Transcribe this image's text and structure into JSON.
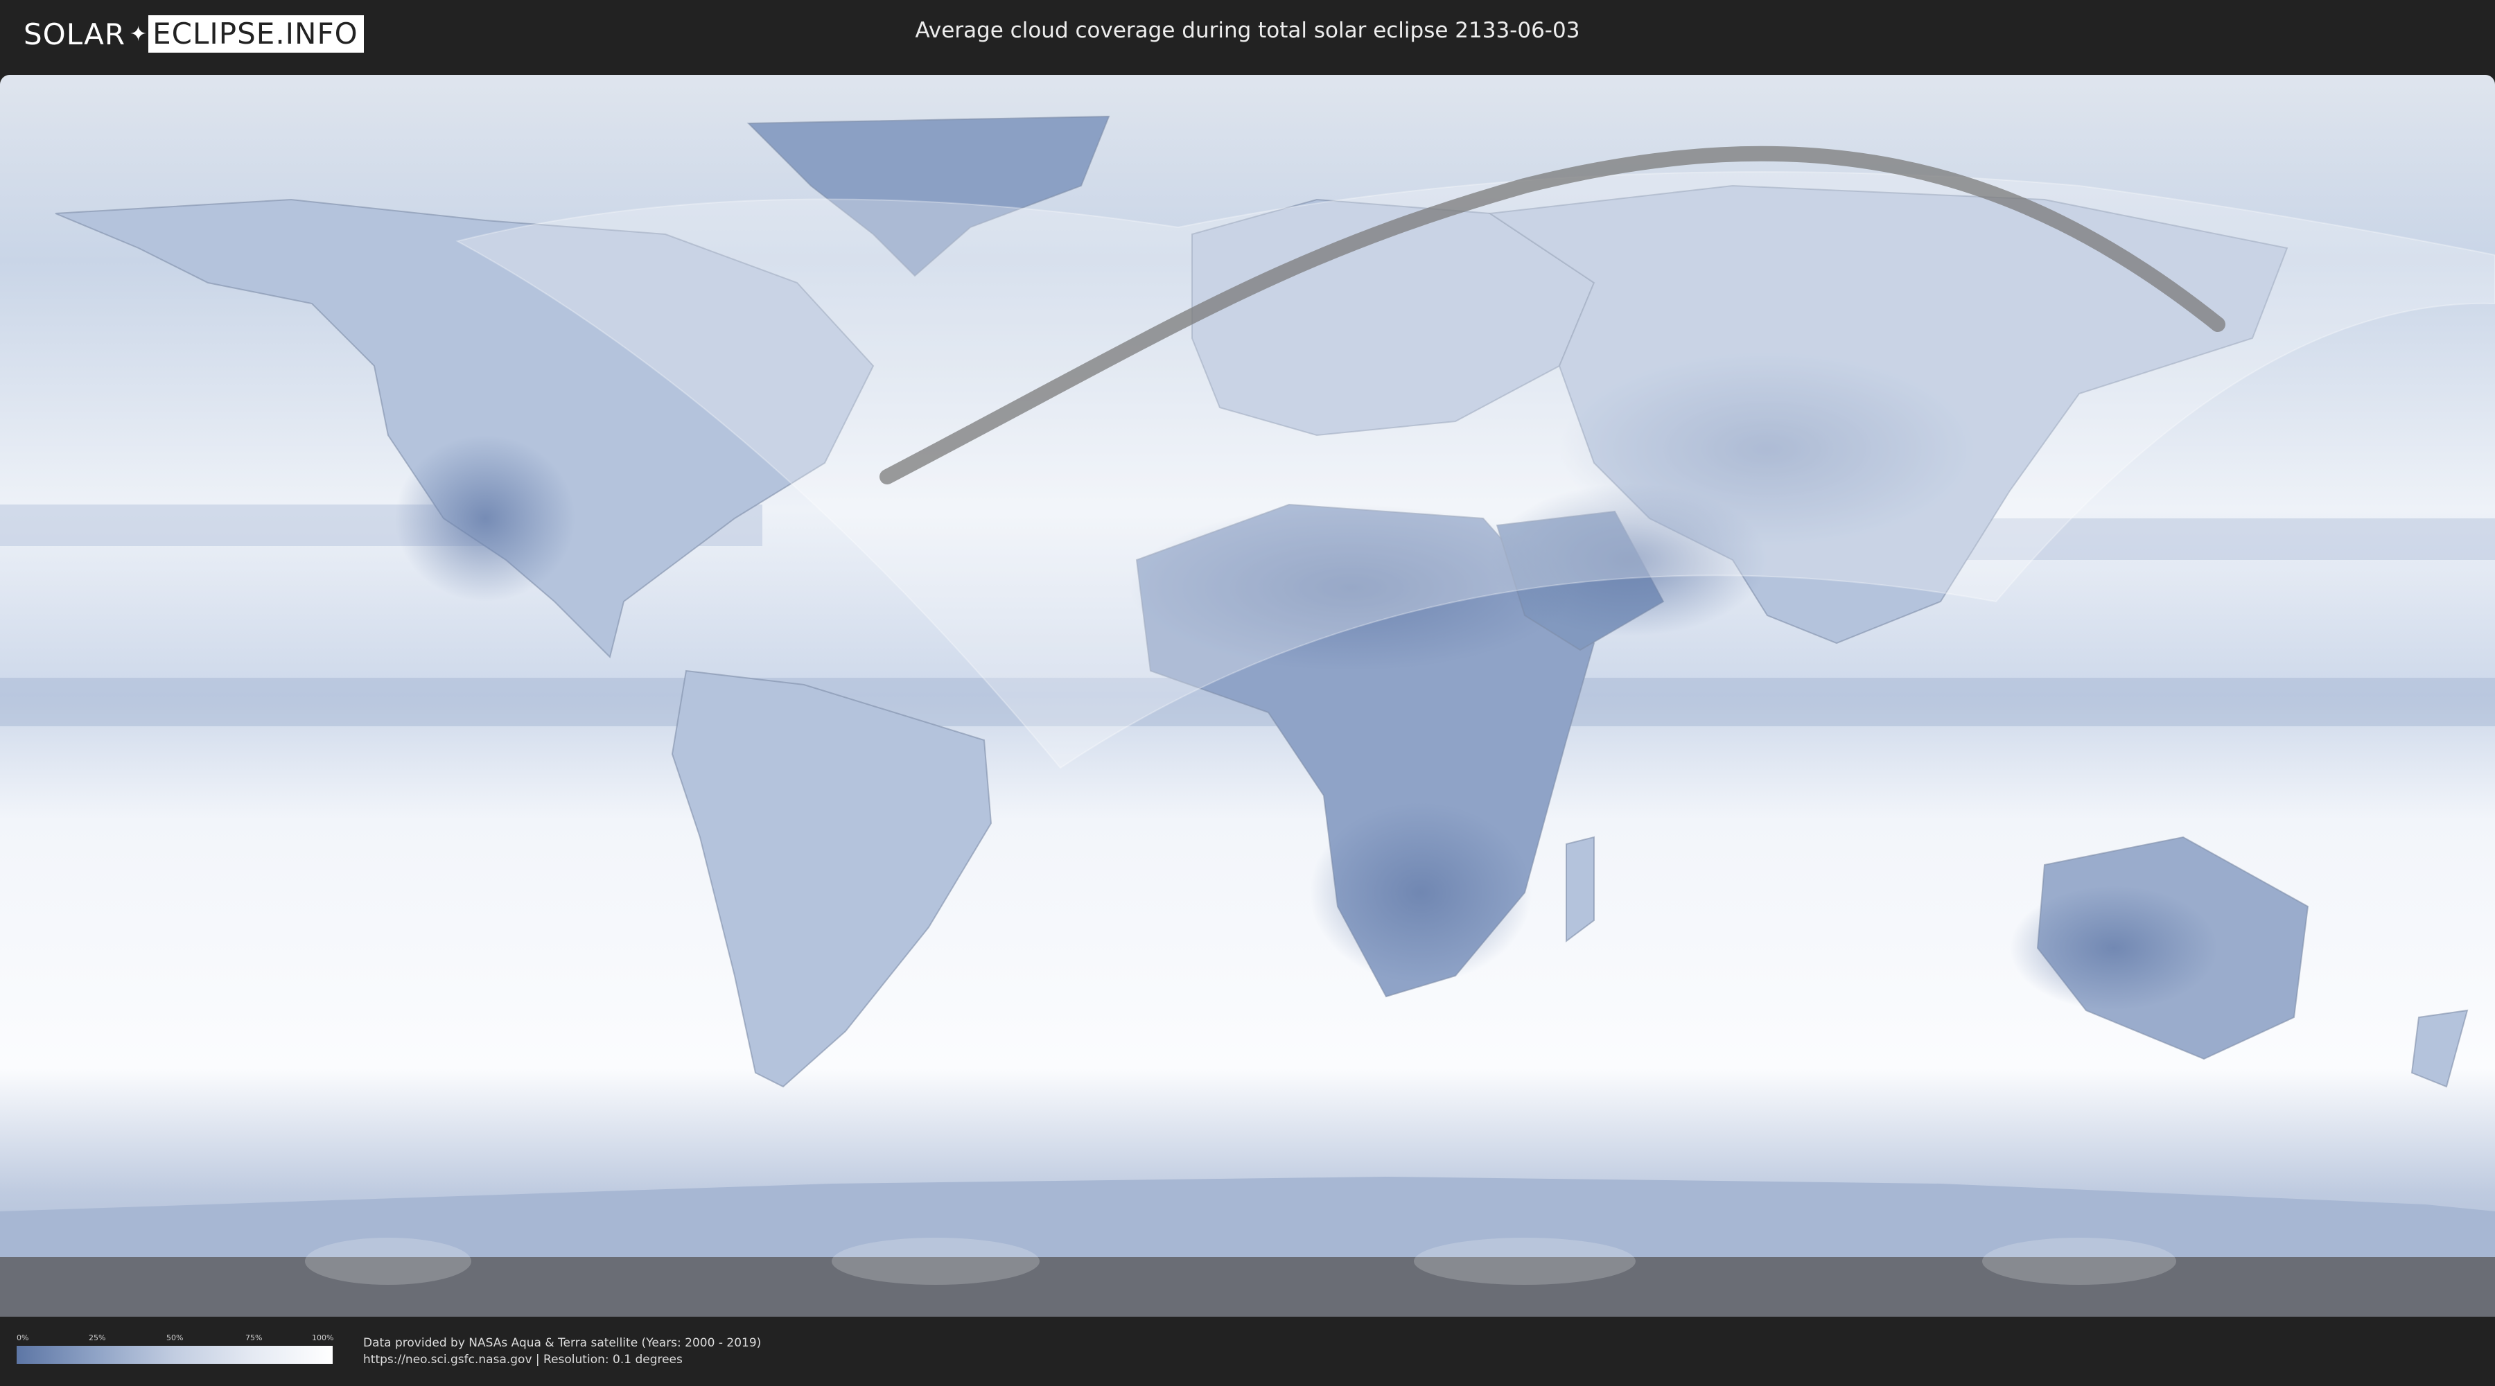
{
  "header": {
    "logo_left": "SOLAR",
    "logo_right": "ECLIPSE.INFO",
    "title": "Average cloud coverage during total solar eclipse 2133-06-03"
  },
  "legend": {
    "ticks": [
      "0%",
      "25%",
      "50%",
      "75%",
      "100%"
    ],
    "color_low": "#5d76a5",
    "color_high": "#ffffff"
  },
  "credits": {
    "line1": "Data provided by NASAs Aqua & Terra satellite (Years: 2000 - 2019)",
    "line2": "https://neo.sci.gsfc.nasa.gov | Resolution: 0.1 degrees"
  },
  "colors": {
    "background": "#222222",
    "ocean": "#e9eef5",
    "cloud_low": "#5d76a5"
  }
}
